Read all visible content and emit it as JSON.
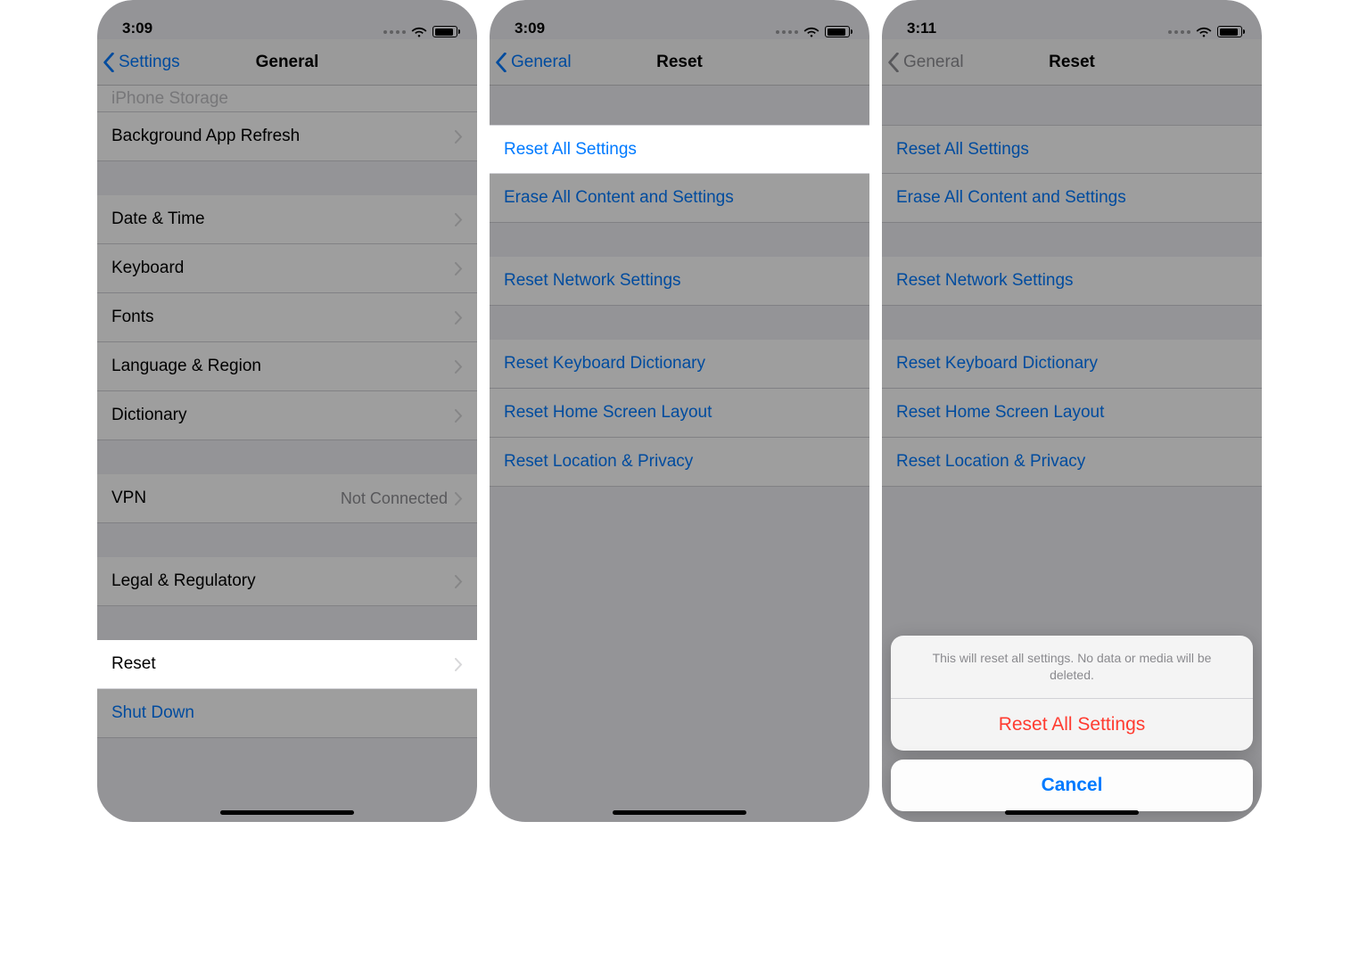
{
  "screen1": {
    "time": "3:09",
    "back_label": "Settings",
    "title": "General",
    "partial_row": "iPhone Storage",
    "rows_a": [
      {
        "label": "Background App Refresh"
      }
    ],
    "rows_b": [
      {
        "label": "Date & Time"
      },
      {
        "label": "Keyboard"
      },
      {
        "label": "Fonts"
      },
      {
        "label": "Language & Region"
      },
      {
        "label": "Dictionary"
      }
    ],
    "vpn": {
      "label": "VPN",
      "value": "Not Connected"
    },
    "legal": {
      "label": "Legal & Regulatory"
    },
    "reset": {
      "label": "Reset"
    },
    "shutdown": {
      "label": "Shut Down"
    }
  },
  "screen2": {
    "time": "3:09",
    "back_label": "General",
    "title": "Reset",
    "group1": [
      {
        "label": "Reset All Settings",
        "highlight": true
      },
      {
        "label": "Erase All Content and Settings"
      }
    ],
    "group2": [
      {
        "label": "Reset Network Settings"
      }
    ],
    "group3": [
      {
        "label": "Reset Keyboard Dictionary"
      },
      {
        "label": "Reset Home Screen Layout"
      },
      {
        "label": "Reset Location & Privacy"
      }
    ]
  },
  "screen3": {
    "time": "3:11",
    "back_label": "General",
    "title": "Reset",
    "group1": [
      {
        "label": "Reset All Settings"
      },
      {
        "label": "Erase All Content and Settings"
      }
    ],
    "group2": [
      {
        "label": "Reset Network Settings"
      }
    ],
    "group3": [
      {
        "label": "Reset Keyboard Dictionary"
      },
      {
        "label": "Reset Home Screen Layout"
      },
      {
        "label": "Reset Location & Privacy"
      }
    ],
    "sheet": {
      "message": "This will reset all settings. No data or media will be deleted.",
      "destructive": "Reset All Settings",
      "cancel": "Cancel"
    }
  },
  "colors": {
    "link": "#007aff",
    "destructive": "#ff3b30",
    "secondary": "#8e8e93"
  }
}
